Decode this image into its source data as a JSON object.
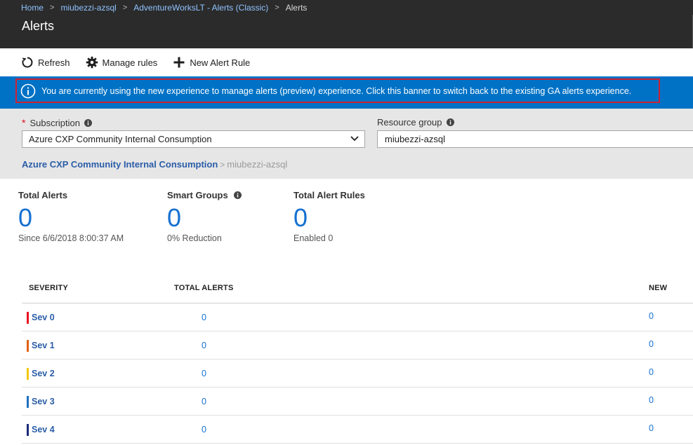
{
  "breadcrumb": [
    {
      "label": "Home"
    },
    {
      "label": "miubezzi-azsql"
    },
    {
      "label": "AdventureWorksLT - Alerts (Classic)"
    }
  ],
  "breadcrumb_current": "Alerts",
  "page_title": "Alerts",
  "toolbar": {
    "refresh": "Refresh",
    "manage_rules": "Manage rules",
    "new_alert_rule": "New Alert Rule"
  },
  "banner": {
    "text": "You are currently using the new experience to manage alerts (preview) experience. Click this banner to switch back to the existing GA alerts experience."
  },
  "filters": {
    "required_marker": "*",
    "subscription_label": "Subscription",
    "subscription_value": "Azure CXP Community Internal Consumption",
    "resource_group_label": "Resource group",
    "resource_group_value": "miubezzi-azsql",
    "scope_subscription": "Azure CXP Community Internal Consumption",
    "scope_resource": "miubezzi-azsql"
  },
  "stats": {
    "total_alerts": {
      "title": "Total Alerts",
      "value": "0",
      "sub": "Since 6/6/2018 8:00:37 AM"
    },
    "smart_groups": {
      "title": "Smart Groups",
      "value": "0",
      "sub": "0% Reduction"
    },
    "total_alert_rules": {
      "title": "Total Alert Rules",
      "value": "0",
      "sub": "Enabled 0"
    }
  },
  "table": {
    "headers": {
      "severity": "SEVERITY",
      "total_alerts": "TOTAL ALERTS",
      "new": "NEW"
    },
    "rows": [
      {
        "severity": "Sev 0",
        "total": "0",
        "new": "0"
      },
      {
        "severity": "Sev 1",
        "total": "0",
        "new": "0"
      },
      {
        "severity": "Sev 2",
        "total": "0",
        "new": "0"
      },
      {
        "severity": "Sev 3",
        "total": "0",
        "new": "0"
      },
      {
        "severity": "Sev 4",
        "total": "0",
        "new": "0"
      }
    ]
  },
  "colors": {
    "banner": "#0072c6",
    "link": "#2a5da8",
    "sev0": "#e81123",
    "sev1": "#e06214",
    "sev2": "#f2c811",
    "sev3": "#1f6fbf",
    "sev4": "#1a2a78"
  }
}
